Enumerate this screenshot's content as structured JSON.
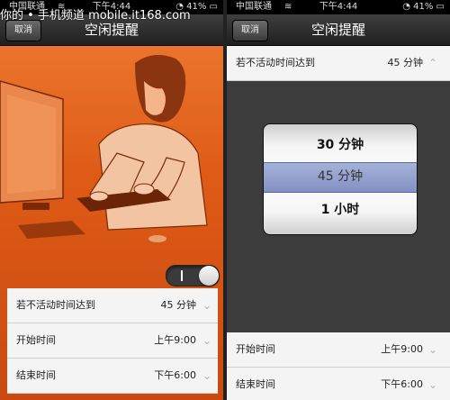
{
  "watermark": "你的 • 手机频道 mobile.it168.com",
  "left": {
    "status": {
      "carrier": "中国联通",
      "time": "下午4:44",
      "battery": "41%"
    },
    "navbar": {
      "cancel": "取消",
      "title": "空闲提醒"
    },
    "toggle": {
      "on": true
    },
    "rows": [
      {
        "label": "若不活动时间达到",
        "value": "45 分钟"
      },
      {
        "label": "开始时间",
        "value": "上午9:00"
      },
      {
        "label": "结束时间",
        "value": "下午6:00"
      }
    ]
  },
  "right": {
    "status": {
      "carrier": "中国联通",
      "time": "下午4:44",
      "battery": "41%"
    },
    "navbar": {
      "cancel": "取消",
      "title": "空闲提醒"
    },
    "top_row": {
      "label": "若不活动时间达到",
      "value": "45 分钟"
    },
    "picker": {
      "options": [
        "30 分钟",
        "45 分钟",
        "1 小时"
      ],
      "selected": "45 分钟"
    },
    "rows": [
      {
        "label": "开始时间",
        "value": "上午9:00"
      },
      {
        "label": "结束时间",
        "value": "下午6:00"
      }
    ]
  }
}
